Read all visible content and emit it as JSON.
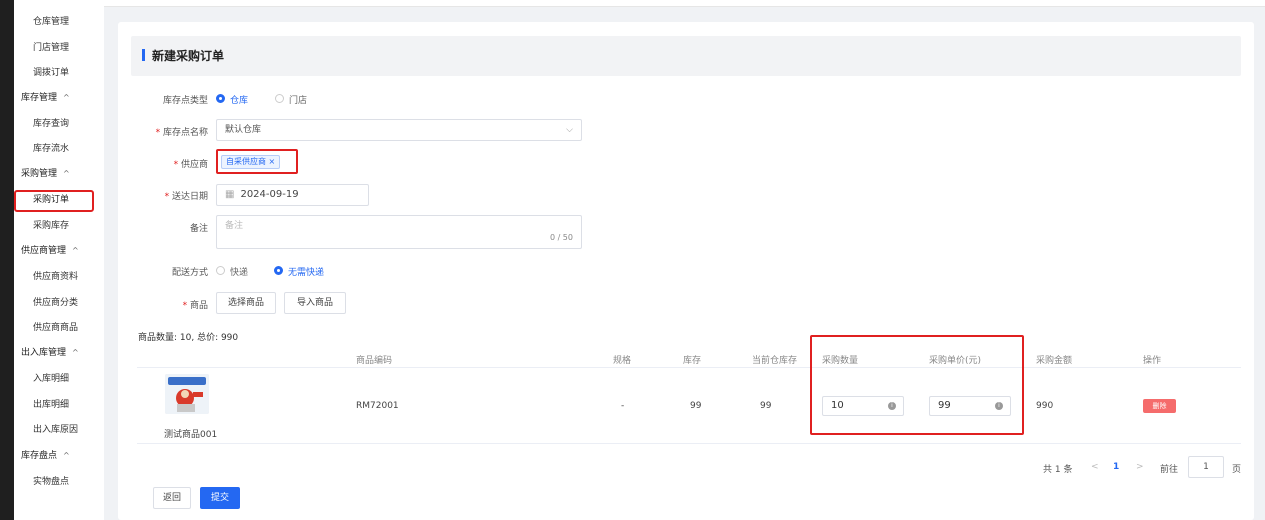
{
  "sidebar": {
    "items": [
      {
        "label": "仓库管理",
        "type": "child"
      },
      {
        "label": "门店管理",
        "type": "child"
      },
      {
        "label": "调拨订单",
        "type": "child"
      },
      {
        "label": "库存管理",
        "type": "group"
      },
      {
        "label": "库存查询",
        "type": "child"
      },
      {
        "label": "库存流水",
        "type": "child"
      },
      {
        "label": "采购管理",
        "type": "group"
      },
      {
        "label": "采购订单",
        "type": "child",
        "active": true
      },
      {
        "label": "采购库存",
        "type": "child"
      },
      {
        "label": "供应商管理",
        "type": "group"
      },
      {
        "label": "供应商资料",
        "type": "child"
      },
      {
        "label": "供应商分类",
        "type": "child"
      },
      {
        "label": "供应商商品",
        "type": "child"
      },
      {
        "label": "出入库管理",
        "type": "group"
      },
      {
        "label": "入库明细",
        "type": "child"
      },
      {
        "label": "出库明细",
        "type": "child"
      },
      {
        "label": "出入库原因",
        "type": "child"
      },
      {
        "label": "库存盘点",
        "type": "group"
      },
      {
        "label": "实物盘点",
        "type": "child"
      }
    ],
    "group_chevron": "^"
  },
  "page": {
    "title": "新建采购订单"
  },
  "form": {
    "location_type": {
      "label": "库存点类型",
      "options": [
        "仓库",
        "门店"
      ],
      "selected": "仓库"
    },
    "location_name": {
      "label": "库存点名称",
      "value": "默认仓库"
    },
    "supplier": {
      "label": "供应商",
      "tag": "自采供应商",
      "tag_close": "×"
    },
    "delivery_date": {
      "label": "送达日期",
      "value": "2024-09-19"
    },
    "remark": {
      "label": "备注",
      "placeholder": "备注",
      "counter": "0 / 50"
    },
    "shipping": {
      "label": "配送方式",
      "options": [
        "快递",
        "无需快递"
      ],
      "selected": "无需快递"
    },
    "goods": {
      "label": "商品",
      "select_button": "选择商品",
      "import_button": "导入商品"
    },
    "required_mark": "*"
  },
  "summary": "商品数量: 10, 总价: 990",
  "table": {
    "headers": [
      "商品编码",
      "规格",
      "库存",
      "当前仓库存",
      "采购数量",
      "采购单价(元)",
      "采购金额",
      "操作"
    ],
    "rows": [
      {
        "name": "测试商品001",
        "code": "RM72001",
        "spec": "-",
        "stock": "99",
        "warehouse_stock": "99",
        "qty": "10",
        "price": "99",
        "amount": "990",
        "action": "删除"
      }
    ]
  },
  "pagination": {
    "total": "共 1 条",
    "prev": "<",
    "current": "1",
    "next": ">",
    "goto_prefix": "前往",
    "goto_value": "1",
    "goto_suffix": "页"
  },
  "footer": {
    "back": "返回",
    "submit": "提交"
  },
  "colors": {
    "primary": "#2468f2",
    "danger": "#f56c6c",
    "highlight": "#e02020"
  }
}
